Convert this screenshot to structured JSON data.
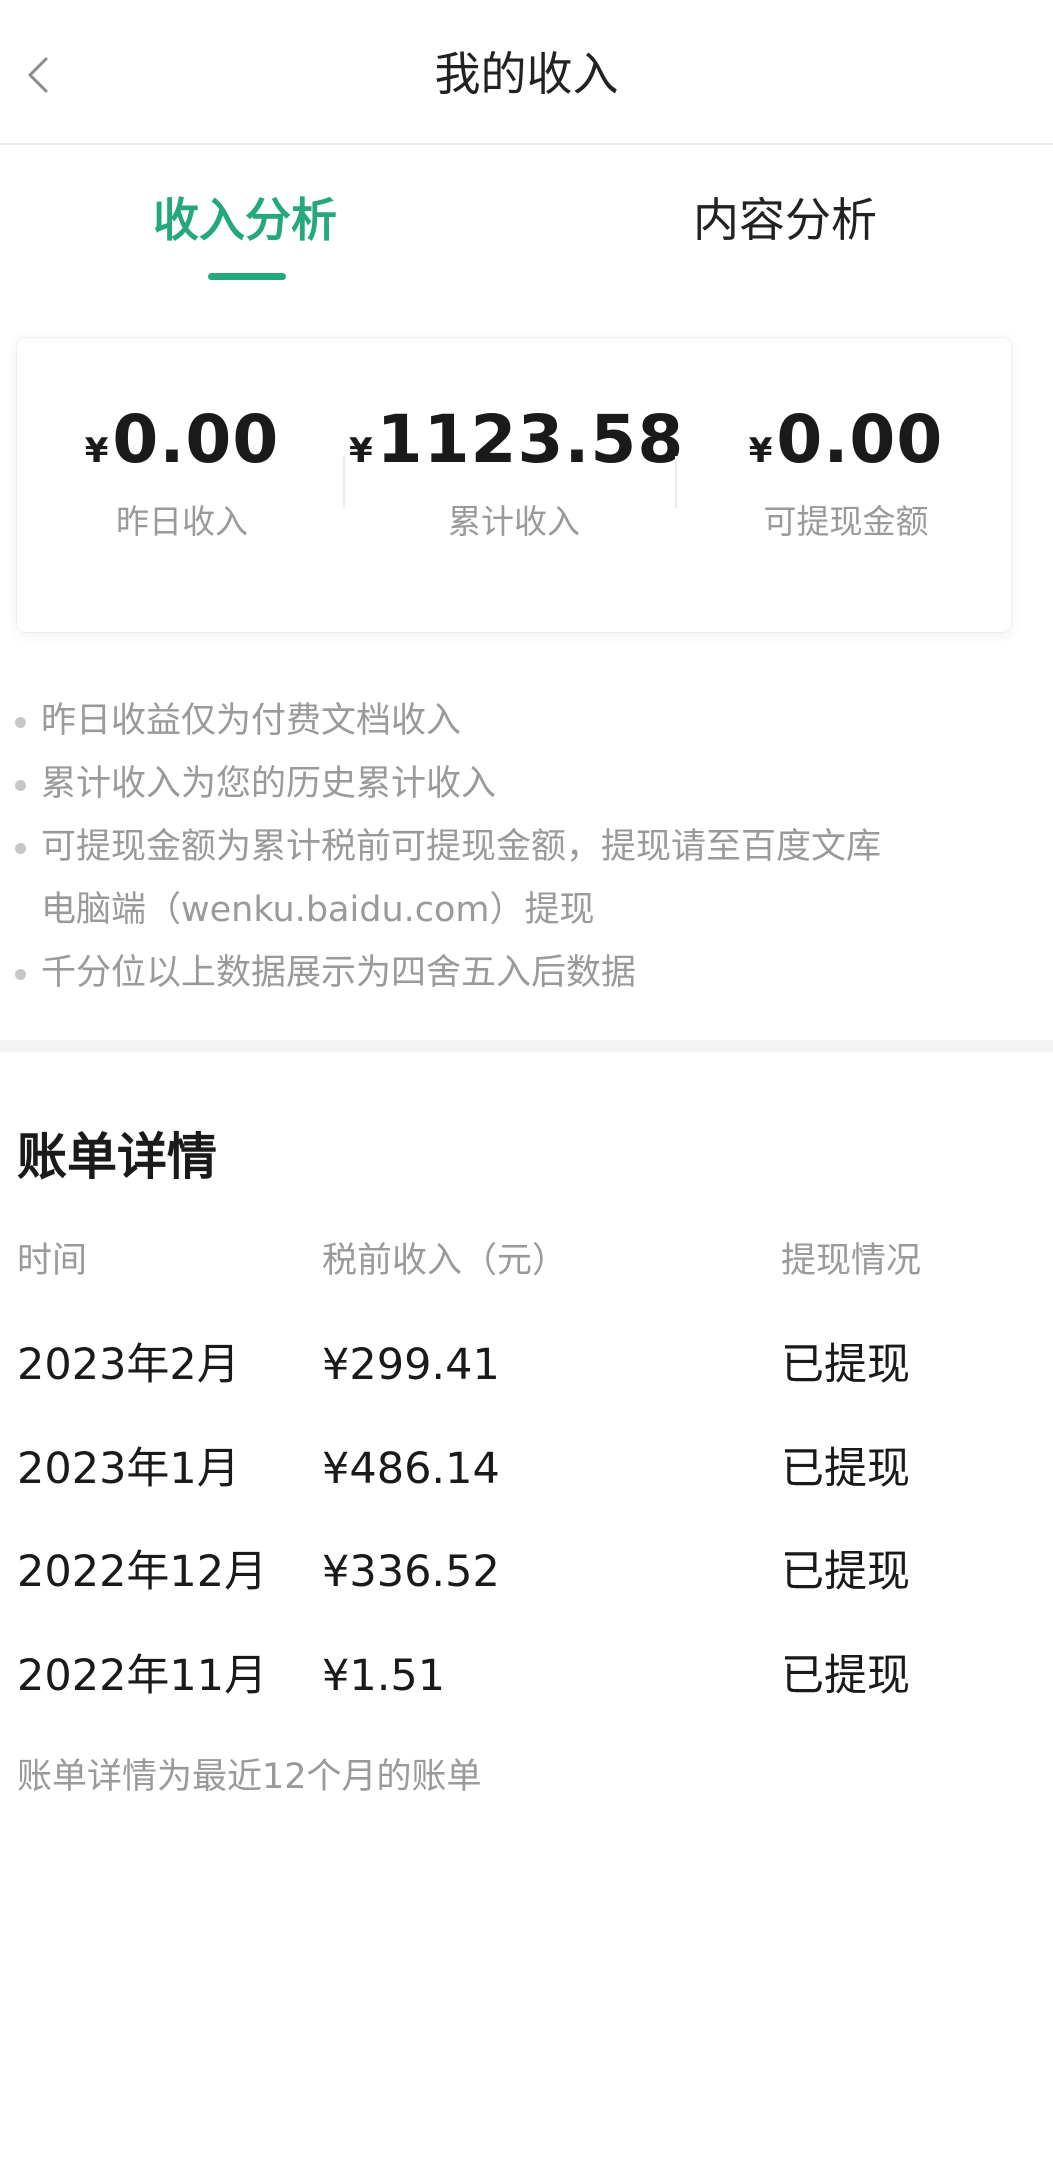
{
  "header": {
    "title": "我的收入",
    "back_icon": "chevron-left-icon"
  },
  "tabs": [
    {
      "label": "收入分析",
      "active": true
    },
    {
      "label": "内容分析",
      "active": false
    }
  ],
  "summary": {
    "currency_symbol": "¥",
    "items": [
      {
        "amount": "0.00",
        "label": "昨日收入"
      },
      {
        "amount": "1123.58",
        "label": "累计收入"
      },
      {
        "amount": "0.00",
        "label": "可提现金额"
      }
    ]
  },
  "notes": [
    "昨日收益仅为付费文档收入",
    "累计收入为您的历史累计收入",
    "可提现金额为累计税前可提现金额，提现请至百度文库",
    "电脑端（wenku.baidu.com）提现",
    "千分位以上数据展示为四舍五入后数据"
  ],
  "bill": {
    "title": "账单详情",
    "columns": [
      "时间",
      "税前收入（元）",
      "提现情况"
    ],
    "rows": [
      {
        "time": "2023年2月",
        "amount": "¥299.41",
        "status": "已提现"
      },
      {
        "time": "2023年1月",
        "amount": "¥486.14",
        "status": "已提现"
      },
      {
        "time": "2022年12月",
        "amount": "¥336.52",
        "status": "已提现"
      },
      {
        "time": "2022年11月",
        "amount": "¥1.51",
        "status": "已提现"
      }
    ],
    "footnote": "账单详情为最近12个月的账单"
  },
  "colors": {
    "accent": "#25a97a",
    "muted_text": "#9a9a9a",
    "primary_text": "#1a1a1a"
  }
}
